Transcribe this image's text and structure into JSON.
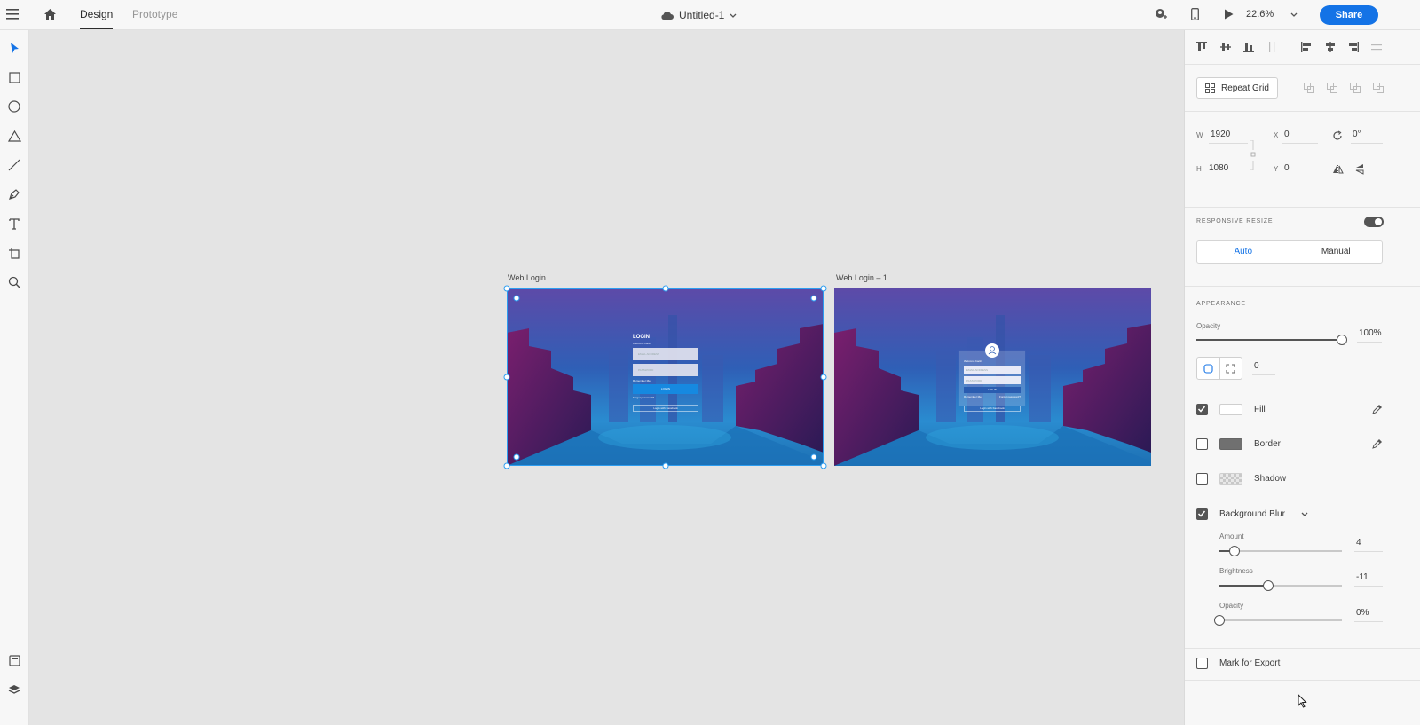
{
  "topbar": {
    "tabs": [
      "Design",
      "Prototype"
    ],
    "document_title": "Untitled-1",
    "zoom": "22.6%",
    "share_label": "Share"
  },
  "canvas": {
    "artboards": [
      {
        "label": "Web Login"
      },
      {
        "label": "Web Login – 1"
      }
    ],
    "login_card": {
      "title": "LOGIN",
      "welcome": "Welcome back!",
      "email_placeholder": "EMAIL ADDRESS",
      "password_placeholder": "PASSWORD",
      "remember": "Remember Me",
      "login_button": "LOG IN",
      "forgot": "Forgot password?",
      "facebook": "Login with Facebook"
    }
  },
  "panel": {
    "repeat_grid_label": "Repeat Grid",
    "transform": {
      "w_label": "W",
      "w_value": "1920",
      "h_label": "H",
      "h_value": "1080",
      "x_label": "X",
      "x_value": "0",
      "y_label": "Y",
      "y_value": "0",
      "rotation": "0°"
    },
    "responsive_resize": {
      "title": "RESPONSIVE RESIZE",
      "enabled": true,
      "auto_label": "Auto",
      "manual_label": "Manual",
      "selected": "Auto"
    },
    "appearance": {
      "title": "APPEARANCE",
      "opacity_label": "Opacity",
      "opacity_value": "100%",
      "opacity_fraction": 1.0,
      "corner_radius": "0",
      "fill_label": "Fill",
      "fill_checked": true,
      "fill_color": "#ffffff",
      "border_label": "Border",
      "border_checked": false,
      "border_color": "#707070",
      "shadow_label": "Shadow",
      "shadow_checked": false,
      "blur_label": "Background Blur",
      "blur_checked": true,
      "amount_label": "Amount",
      "amount_value": "4",
      "amount_fraction": 0.12,
      "brightness_label": "Brightness",
      "brightness_value": "-11",
      "brightness_fraction": 0.4,
      "blur_opacity_label": "Opacity",
      "blur_opacity_value": "0%",
      "blur_opacity_fraction": 0.0
    },
    "export_label": "Mark for Export",
    "export_checked": false
  },
  "colors": {
    "accent": "#1473e6",
    "selection": "#2d9df0"
  }
}
